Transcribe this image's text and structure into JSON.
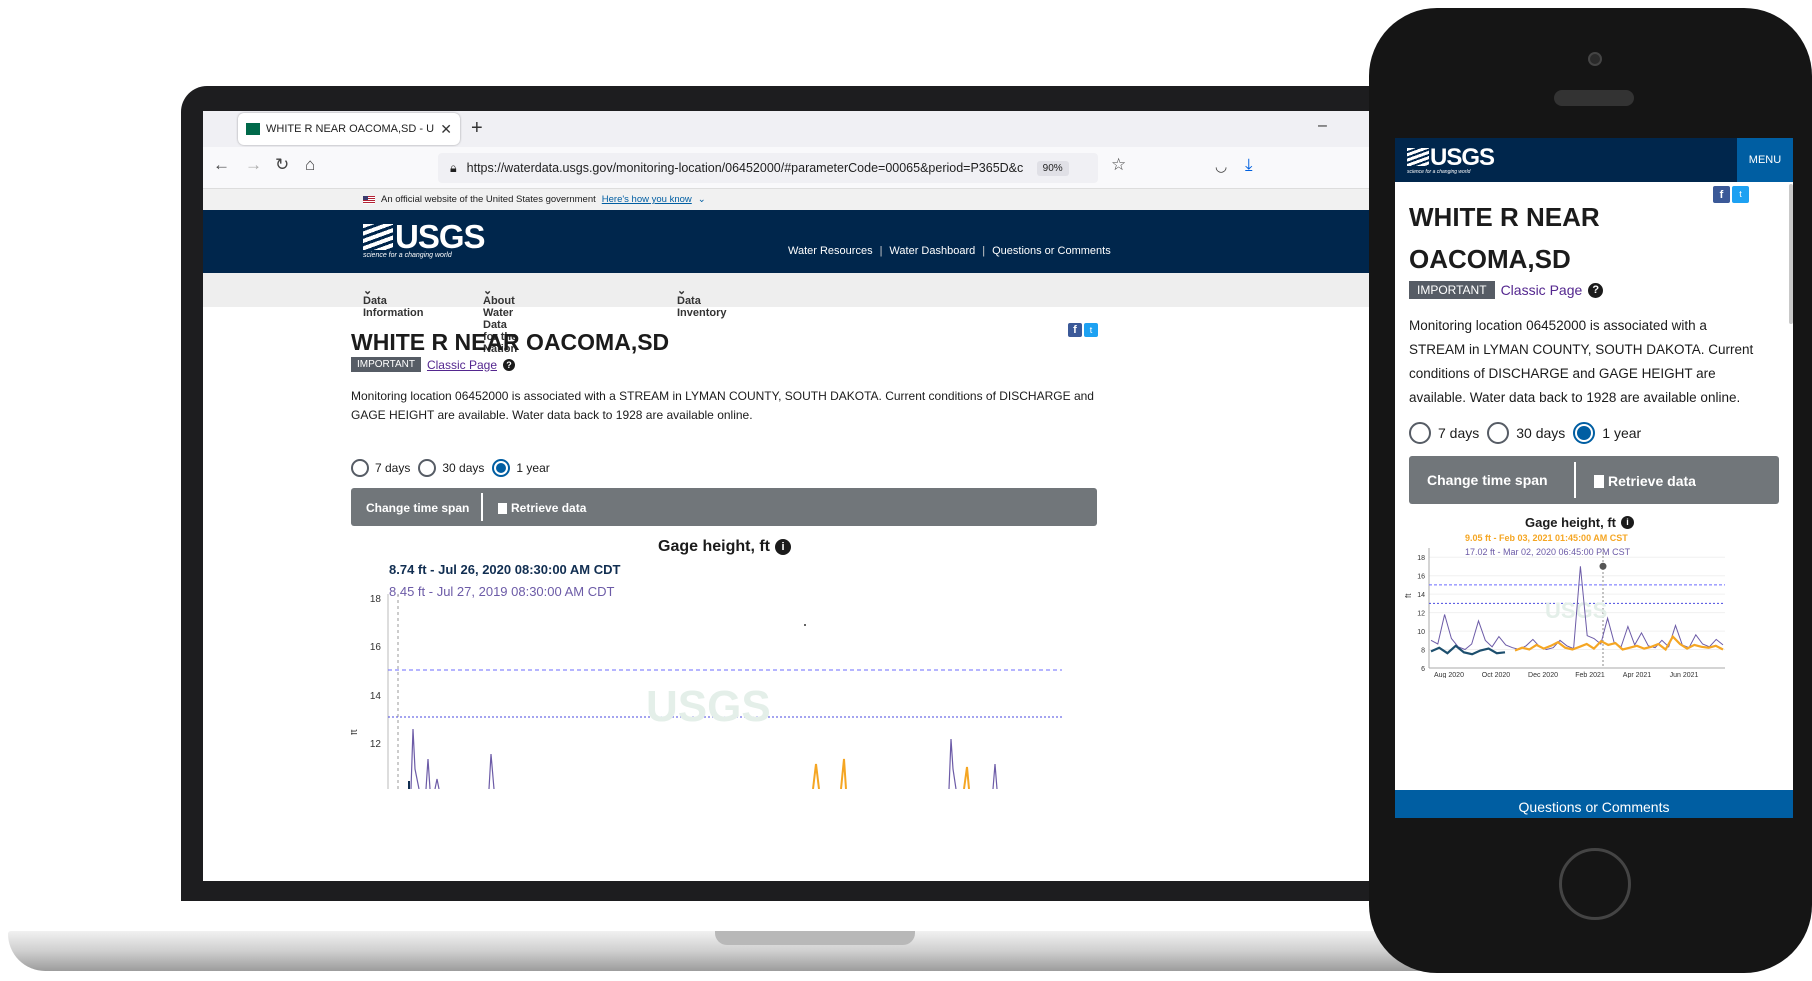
{
  "browser": {
    "tab_title": "WHITE R NEAR OACOMA,SD - U",
    "url": "https://waterdata.usgs.gov/monitoring-location/06452000/#parameterCode=00065&period=P365D&c",
    "zoom": "90%"
  },
  "gov_banner": {
    "text": "An official website of the United States government",
    "link": "Here's how you know"
  },
  "header": {
    "logo": "USGS",
    "tagline": "science for a changing world",
    "links": [
      "Water Resources",
      "Water Dashboard",
      "Questions or Comments"
    ]
  },
  "subnav": [
    "Data Information",
    "About Water Data for the Nation",
    "Data Inventory"
  ],
  "page": {
    "title": "WHITE R NEAR OACOMA,SD",
    "title_line1": "WHITE R NEAR",
    "title_line2": "OACOMA,SD",
    "badge": "IMPORTANT",
    "classic_link": "Classic Page",
    "description": "Monitoring location 06452000 is associated with a STREAM in LYMAN COUNTY, SOUTH DAKOTA. Current conditions of DISCHARGE and GAGE HEIGHT are available. Water data back to 1928 are available online.",
    "periods": [
      "7 days",
      "30 days",
      "1 year"
    ],
    "selected_period": "1 year",
    "change_time_span": "Change time span",
    "retrieve_data": "Retrieve data"
  },
  "laptop_chart": {
    "title": "Gage height, ft",
    "tooltip_current": "8.74 ft - Jul 26, 2020 08:30:00 AM CDT",
    "tooltip_compare": "8.45 ft - Jul 27, 2019 08:30:00 AM CDT",
    "y_ticks": [
      "18",
      "16",
      "14",
      "12"
    ],
    "ylabel": "ft"
  },
  "phone": {
    "menu": "MENU",
    "footer": "Questions or Comments",
    "chart": {
      "title": "Gage height, ft",
      "tooltip_current": "9.05 ft - Feb 03, 2021 01:45:00 AM CST",
      "tooltip_compare": "17.02 ft - Mar 02, 2020 06:45:00 PM CST",
      "y_ticks": [
        "18",
        "16",
        "14",
        "12",
        "10",
        "8",
        "6"
      ],
      "x_ticks": [
        "Aug 2020",
        "Oct 2020",
        "Dec 2020",
        "Feb 2021",
        "Apr 2021",
        "Jun 2021"
      ],
      "ylabel": "ft"
    }
  },
  "chart_data": {
    "type": "line",
    "title": "Gage height, ft",
    "ylabel": "ft",
    "ylim": [
      6,
      19
    ],
    "x_ticks": [
      "Aug 2020",
      "Oct 2020",
      "Dec 2020",
      "Feb 2021",
      "Apr 2021",
      "Jun 2021"
    ],
    "series": [
      {
        "values": [
          7.8,
          8.2,
          7.6,
          8.4,
          7.7,
          7.5,
          7.9,
          8.1,
          7.6,
          7.7
        ]
      },
      {
        "values": [
          7.9,
          8.2,
          8.0,
          8.5,
          8.1,
          8.4,
          8.8,
          8.2,
          8.0,
          8.3,
          8.6,
          8.1,
          8.9,
          8.5,
          8.7,
          8.0,
          8.2,
          8.4,
          8.1,
          8.3,
          8.6,
          8.0,
          9.4,
          8.6,
          8.1,
          8.5,
          8.3,
          8.2,
          8.4,
          8.0
        ]
      },
      {
        "values": [
          9.0,
          8.6,
          11.8,
          9.2,
          8.3,
          8.0,
          8.6,
          11.1,
          9.0,
          8.3,
          9.4,
          8.5,
          8.2,
          8.0,
          8.4,
          9.1,
          8.3,
          8.0,
          8.2,
          9.0,
          8.4,
          8.1,
          17.02,
          9.5,
          9.2,
          8.6,
          11.4,
          8.7,
          8.3,
          10.5,
          8.5,
          9.8,
          8.4,
          8.2,
          9.0,
          8.3,
          10.6,
          8.5,
          8.2,
          9.6,
          8.6,
          8.3,
          9.1,
          8.5
        ]
      }
    ],
    "thresholds": [
      15.0,
      13.0
    ]
  }
}
